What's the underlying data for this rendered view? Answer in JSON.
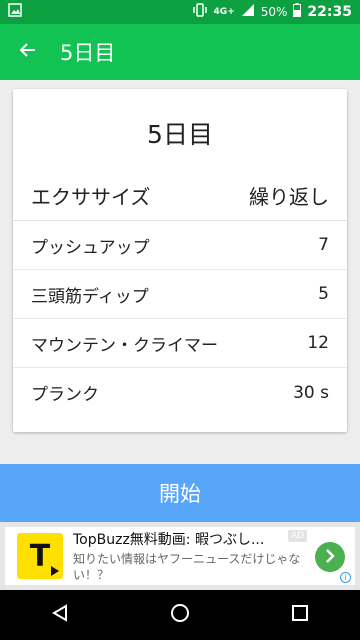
{
  "status_bar": {
    "network": "4G+",
    "battery": "50%",
    "time": "22:35"
  },
  "app_bar": {
    "title": "5日目"
  },
  "card": {
    "title": "5日目",
    "header": {
      "exercise": "エクササイズ",
      "reps": "繰り返し"
    },
    "rows": [
      {
        "name": "プッシュアップ",
        "reps": "7"
      },
      {
        "name": "三頭筋ディップ",
        "reps": "5"
      },
      {
        "name": "マウンテン・クライマー",
        "reps": "12"
      },
      {
        "name": "プランク",
        "reps": "30 s"
      }
    ]
  },
  "start_button": {
    "label": "開始"
  },
  "ad": {
    "badge": "AD",
    "title": "TopBuzz無料動画: 暇つぶし...",
    "description": "知りたい情報はヤフーニュースだけじゃない！？",
    "logo_letter": "T"
  },
  "colors": {
    "status_bar": "#0ca040",
    "app_bar": "#12c252",
    "start_button": "#58a6fa",
    "ad_arrow": "#4caf50"
  }
}
